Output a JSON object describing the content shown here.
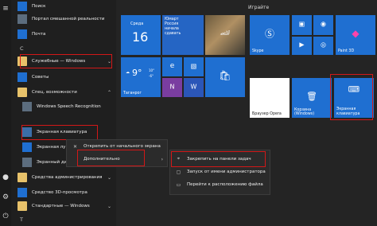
{
  "applist": {
    "top_items": [
      {
        "label": "Поиск",
        "icon": "search-icon"
      },
      {
        "label": "Портал смешанной реальности",
        "icon": "mixed-reality-icon"
      },
      {
        "label": "Почта",
        "icon": "mail-icon"
      }
    ],
    "letter_c": "С",
    "items": [
      {
        "label": "Служебные — Windows",
        "icon": "folder-icon"
      },
      {
        "label": "Советы",
        "icon": "tips-icon"
      },
      {
        "label": "Спец. возможности",
        "icon": "folder-icon"
      },
      {
        "label": "Windows Speech Recognition",
        "icon": "microphone-icon"
      },
      {
        "label": "Экранная клавиатура",
        "icon": "keyboard-icon"
      },
      {
        "label": "Экранная лу",
        "icon": "magnifier-icon"
      },
      {
        "label": "Экранный ди",
        "icon": "narrator-icon"
      },
      {
        "label": "Средства администрирования",
        "icon": "folder-icon"
      },
      {
        "label": "Средство 3D-просмотра",
        "icon": "3d-viewer-icon"
      },
      {
        "label": "Стандартные — Windows",
        "icon": "folder-icon"
      }
    ],
    "letter_t": "Т"
  },
  "tiles": {
    "group_left": "",
    "group_right": "Играйте",
    "calendar": {
      "day": "Среда",
      "date": "16"
    },
    "news": {
      "line1": "Юмарт",
      "line2": "Россия",
      "line3": "начала",
      "line4": "сдавать"
    },
    "weather": {
      "temp": "9°",
      "range1": "10°",
      "range2": "-6°",
      "city": "Таганрог"
    },
    "skype": "Skype",
    "paint3d": "Paint 3D",
    "opera": "Браузер Opera",
    "recycle": "Корзина (Windows)",
    "keyboard": {
      "line1": "Экранная",
      "line2": "клавиатура"
    }
  },
  "context_menu": {
    "items": [
      {
        "label": "Открепить от начального экрана",
        "icon": "unpin-icon"
      },
      {
        "label": "Дополнительно",
        "icon": "more-icon"
      }
    ]
  },
  "submenu": {
    "items": [
      {
        "label": "Закрепить на панели задач",
        "icon": "pin-taskbar-icon"
      },
      {
        "label": "Запуск от имени администратора",
        "icon": "admin-icon"
      },
      {
        "label": "Перейти к расположению файла",
        "icon": "folder-open-icon"
      }
    ]
  },
  "colors": {
    "accent": "#1f6fd1",
    "highlight": "#d21818"
  }
}
